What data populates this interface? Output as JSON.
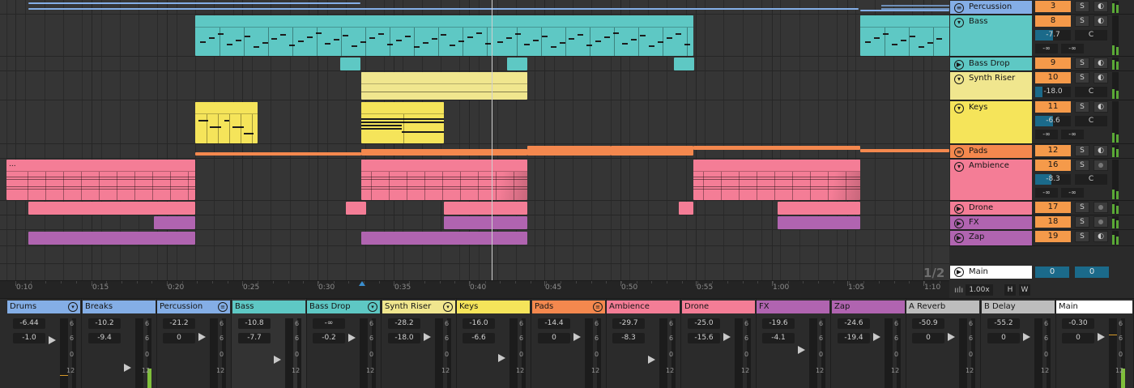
{
  "ruler": {
    "ticks": [
      "0:10",
      "0:15",
      "0:20",
      "0:25",
      "0:30",
      "0:35",
      "0:40",
      "0:45",
      "0:50",
      "0:55",
      "1:00",
      "1:05",
      "1:10"
    ]
  },
  "arrangement": {
    "page_counter": "1/2",
    "ambience_clip_label": "..."
  },
  "colors": {
    "teal": "#5ec8c4",
    "yellow_light": "#f0e68e",
    "yellow": "#f5e45a",
    "orange": "#f4884e",
    "pink": "#f47d96",
    "purple": "#b064b0",
    "blue": "#84aee6",
    "white": "#ffffff",
    "grey": "#bdbdbd",
    "vol_blue": "#1b6a8a",
    "num_orange": "#f59a4a"
  },
  "tracks": [
    {
      "name": "Percussion",
      "num": "3",
      "solo": "S",
      "icon": "list-icon"
    },
    {
      "name": "Bass",
      "num": "8",
      "solo": "S",
      "vol": "-7.7",
      "pan": "C",
      "send_a": "-∞",
      "send_b": "-∞",
      "icon": "chevron-down-icon"
    },
    {
      "name": "Bass Drop",
      "num": "9",
      "solo": "S",
      "icon": "play-icon"
    },
    {
      "name": "Synth Riser",
      "num": "10",
      "solo": "S",
      "vol": "-18.0",
      "pan": "C",
      "icon": "chevron-down-icon"
    },
    {
      "name": "Keys",
      "num": "11",
      "solo": "S",
      "vol": "-6.6",
      "pan": "C",
      "send_a": "-∞",
      "send_b": "-∞",
      "icon": "chevron-down-icon"
    },
    {
      "name": "Pads",
      "num": "12",
      "solo": "S",
      "icon": "list-icon"
    },
    {
      "name": "Ambience",
      "num": "16",
      "solo": "S",
      "vol": "-8.3",
      "pan": "C",
      "send_a": "-∞",
      "send_b": "-∞",
      "icon": "chevron-down-icon"
    },
    {
      "name": "Drone",
      "num": "17",
      "solo": "S",
      "icon": "play-icon"
    },
    {
      "name": "FX",
      "num": "18",
      "solo": "S",
      "icon": "play-icon"
    },
    {
      "name": "Zap",
      "num": "19",
      "solo": "S",
      "icon": "play-icon"
    }
  ],
  "main": {
    "name": "Main",
    "vol_a": "0",
    "vol_b": "0"
  },
  "zoom": {
    "value": "1.00x",
    "h_label": "H",
    "w_label": "W"
  },
  "mixer": {
    "scale": [
      "6",
      "6",
      "0",
      "6",
      "12"
    ],
    "strips": [
      {
        "name": "Drums",
        "peak": "-6.44",
        "vol": "-1.0",
        "icon": "chevron-down-icon"
      },
      {
        "name": "Breaks",
        "peak": "-10.2",
        "vol": "-9.4"
      },
      {
        "name": "Percussion",
        "peak": "-21.2",
        "vol": "0",
        "icon": "list-icon"
      },
      {
        "name": "Bass",
        "peak": "-10.8",
        "vol": "-7.7"
      },
      {
        "name": "Bass Drop",
        "peak": "-∞",
        "vol": "-0.2",
        "icon": "chevron-down-icon"
      },
      {
        "name": "Synth Riser",
        "peak": "-28.2",
        "vol": "-18.0",
        "icon": "chevron-down-icon"
      },
      {
        "name": "Keys",
        "peak": "-16.0",
        "vol": "-6.6"
      },
      {
        "name": "Pads",
        "peak": "-14.4",
        "vol": "0",
        "icon": "list-icon"
      },
      {
        "name": "Ambience",
        "peak": "-29.7",
        "vol": "-8.3"
      },
      {
        "name": "Drone",
        "peak": "-25.0",
        "vol": "-15.6"
      },
      {
        "name": "FX",
        "peak": "-19.6",
        "vol": "-4.1"
      },
      {
        "name": "Zap",
        "peak": "-24.6",
        "vol": "-19.4"
      },
      {
        "name": "A Reverb",
        "peak": "-50.9",
        "vol": "0"
      },
      {
        "name": "B Delay",
        "peak": "-55.2",
        "vol": "0"
      },
      {
        "name": "Main",
        "peak": "-0.30",
        "vol": "0"
      }
    ]
  }
}
